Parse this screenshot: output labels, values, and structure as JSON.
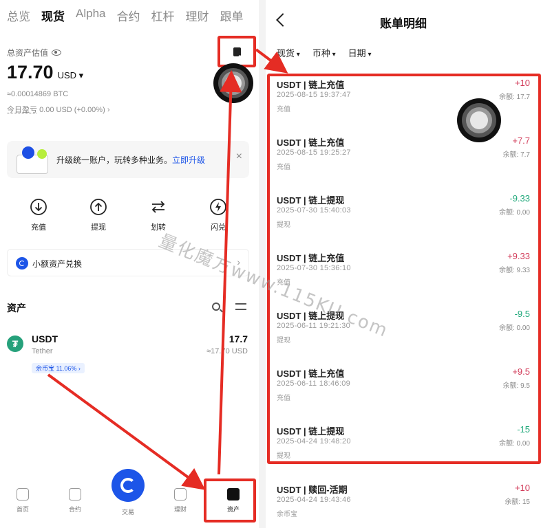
{
  "left": {
    "top_tabs": [
      "总览",
      "现货",
      "Alpha",
      "合约",
      "杠杆",
      "理财",
      "跟单"
    ],
    "active_tab": "现货",
    "est_label": "总资产估值",
    "balance": "17.70",
    "balance_currency": "USD",
    "btc_value": "≈0.00014869 BTC",
    "pnl_label": "今日盈亏",
    "pnl_value": "0.00 USD (+0.00%)",
    "promo_text": "升级统一账户，玩转多种业务。",
    "promo_link": "立即升级",
    "promo_close": "×",
    "actions": [
      {
        "label": "充值",
        "icon": "deposit-icon"
      },
      {
        "label": "提现",
        "icon": "withdraw-icon"
      },
      {
        "label": "划转",
        "icon": "transfer-icon"
      },
      {
        "label": "闪兑",
        "icon": "flash-swap-icon"
      }
    ],
    "mini_swap_label": "小额资产兑换",
    "assets_title": "资产",
    "asset": {
      "symbol": "USDT",
      "name": "Tether",
      "amount": "17.7",
      "usd": "≈17.70 USD",
      "badge": "余币宝 11.06%"
    },
    "bottom_nav": [
      {
        "label": "首页",
        "icon": "home-icon"
      },
      {
        "label": "合约",
        "icon": "futures-icon"
      },
      {
        "label": "交易",
        "icon": "trade-icon"
      },
      {
        "label": "理财",
        "icon": "earn-icon"
      },
      {
        "label": "资产",
        "icon": "assets-icon"
      }
    ],
    "active_nav": "资产"
  },
  "right": {
    "title": "账单明细",
    "filters": [
      "现货",
      "币种",
      "日期"
    ],
    "records": [
      {
        "title": "USDT | 链上充值",
        "datetime": "2025-08-15 19:37:47",
        "kind": "充值",
        "amount": "+10",
        "balance": "余额: 17.7",
        "sign": "pos"
      },
      {
        "title": "USDT | 链上充值",
        "datetime": "2025-08-15 19:25:27",
        "kind": "充值",
        "amount": "+7.7",
        "balance": "余额: 7.7",
        "sign": "pos"
      },
      {
        "title": "USDT | 链上提现",
        "datetime": "2025-07-30 15:40:03",
        "kind": "提现",
        "amount": "-9.33",
        "balance": "余额: 0.00",
        "sign": "neg"
      },
      {
        "title": "USDT | 链上充值",
        "datetime": "2025-07-30 15:36:10",
        "kind": "充值",
        "amount": "+9.33",
        "balance": "余额: 9.33",
        "sign": "pos"
      },
      {
        "title": "USDT | 链上提现",
        "datetime": "2025-06-11 19:21:30",
        "kind": "提现",
        "amount": "-9.5",
        "balance": "余额: 0.00",
        "sign": "neg"
      },
      {
        "title": "USDT | 链上充值",
        "datetime": "2025-06-11 18:46:09",
        "kind": "充值",
        "amount": "+9.5",
        "balance": "余额: 9.5",
        "sign": "pos"
      },
      {
        "title": "USDT | 链上提现",
        "datetime": "2025-04-24 19:48:20",
        "kind": "提现",
        "amount": "-15",
        "balance": "余额: 0.00",
        "sign": "neg"
      },
      {
        "title": "USDT | 赎回-活期",
        "datetime": "2025-04-24 19:43:46",
        "kind": "余币宝",
        "amount": "+10",
        "balance": "余额: 15",
        "sign": "pos"
      }
    ]
  },
  "watermark": "量化魔方www.115KU.com",
  "colors": {
    "annotation_red": "#e52c24",
    "brand_blue": "#1d55e8",
    "positive": "#d23c5a",
    "negative": "#1fa87a",
    "tether_green": "#26a17b"
  }
}
